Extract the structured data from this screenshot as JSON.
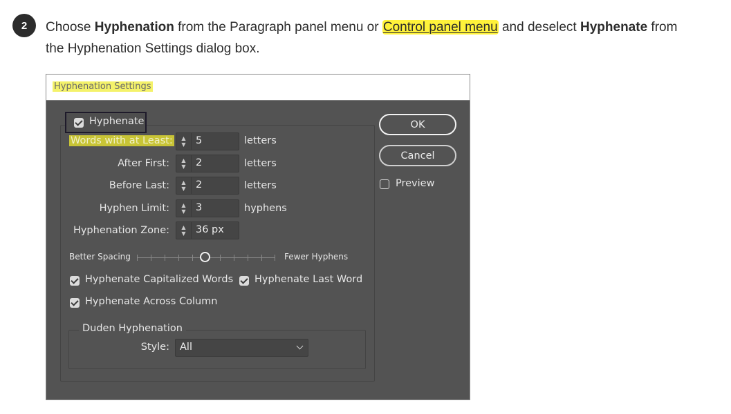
{
  "step": {
    "number": "2"
  },
  "instruction": {
    "t1": "Choose ",
    "b1": "Hyphenation",
    "t2": " from the Paragraph panel menu or ",
    "hl": "Control panel menu",
    "t3": " and deselect ",
    "b2": "Hyphenate",
    "t4": " from the Hyphenation Settings dialog box."
  },
  "dialog": {
    "title": "Hyphenation Settings",
    "hyphenate": {
      "label": "Hyphenate",
      "checked": true
    },
    "fields": [
      {
        "label": "Words with at Least:",
        "value": "5",
        "unit": "letters"
      },
      {
        "label": "After First:",
        "value": "2",
        "unit": "letters"
      },
      {
        "label": "Before Last:",
        "value": "2",
        "unit": "letters"
      },
      {
        "label": "Hyphen Limit:",
        "value": "3",
        "unit": "hyphens"
      },
      {
        "label": "Hyphenation Zone:",
        "value": "36 px",
        "unit": ""
      }
    ],
    "slider": {
      "left_label": "Better Spacing",
      "right_label": "Fewer Hyphens",
      "position": 0.5
    },
    "options": [
      {
        "label": "Hyphenate Capitalized Words",
        "checked": true
      },
      {
        "label": "Hyphenate Last Word",
        "checked": true
      },
      {
        "label": "Hyphenate Across Column",
        "checked": true
      }
    ],
    "duden": {
      "title": "Duden Hyphenation",
      "style_label": "Style:",
      "style_value": "All"
    },
    "buttons": {
      "ok": "OK",
      "cancel": "Cancel"
    },
    "preview": {
      "label": "Preview",
      "checked": false
    }
  }
}
